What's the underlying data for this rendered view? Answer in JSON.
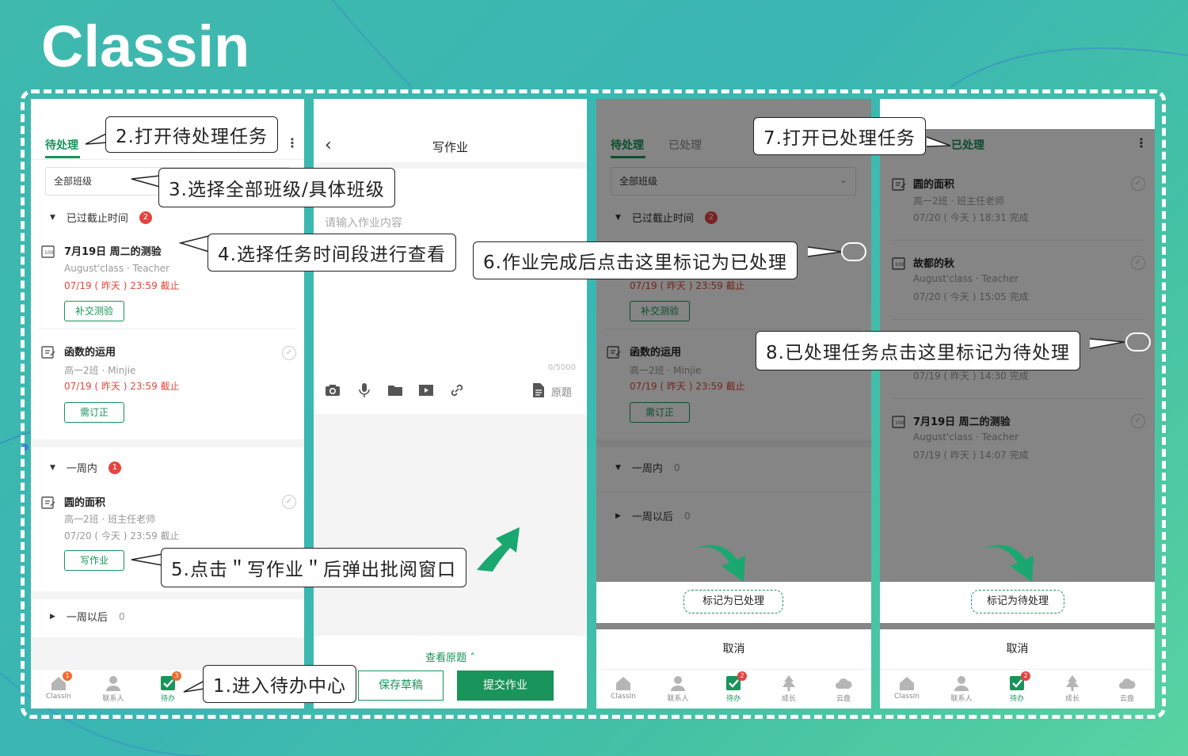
{
  "brand": {
    "logo_text": "Classin"
  },
  "panel1": {
    "tab_active": "待处理",
    "class_select": "全部班级",
    "section_overdue": {
      "label": "已过截止时间",
      "count": "2"
    },
    "task1": {
      "title": "7月19日 周二的测验",
      "meta": "August'class · Teacher",
      "due": "07/19 ( 昨天 ) 23:59 截止",
      "button": "补交测验"
    },
    "task2": {
      "title": "函数的运用",
      "meta": "高一2班 · Minjie",
      "due": "07/19 ( 昨天 ) 23:59 截止",
      "button": "需订正"
    },
    "section_week": {
      "label": "一周内",
      "count": "1"
    },
    "task3": {
      "title": "圆的面积",
      "meta": "高一2班 · 班主任老师",
      "due": "07/20 ( 今天 ) 23:59 截止",
      "button": "写作业"
    },
    "section_later": {
      "label": "一周以后",
      "count": "0"
    }
  },
  "panel2": {
    "title": "写作业",
    "placeholder": "请输入作业内容",
    "counter": "0/5000",
    "original_label": "原题",
    "view_original": "查看原题",
    "save_draft": "保存草稿",
    "submit": "提交作业"
  },
  "panel3": {
    "tab_active": "待处理",
    "tab_inactive": "已处理",
    "class_select": "全部班级",
    "section_overdue": {
      "label": "已过截止时间",
      "count": "2"
    },
    "partial_due": "07/19 ( 昨天 ) 23:59 截止",
    "button1": "补交测验",
    "task2": {
      "title": "函数的运用",
      "meta": "高一2班 · Minjie",
      "due": "07/19 ( 昨天 ) 23:59 截止",
      "button": "需订正"
    },
    "section_week": {
      "label": "一周内",
      "count": "0"
    },
    "section_later": {
      "label": "一周以后",
      "count": "0"
    },
    "sheet_action": "标记为已处理",
    "sheet_cancel": "取消"
  },
  "panel4": {
    "tab_active": "已处理",
    "item1": {
      "title": "圆的面积",
      "meta": "高一2班 · 班主任老师",
      "done": "07/20 ( 今天 ) 18:31 完成"
    },
    "item2": {
      "title": "故都的秋",
      "meta": "August'class · Teacher",
      "done": "07/20 ( 今天 ) 15:05 完成"
    },
    "item3_partial": "07/19 ( 昨天 ) 14:30 完成",
    "item4": {
      "title": "7月19日 周二的测验",
      "meta": "August'class · Teacher",
      "done": "07/19 ( 昨天 ) 14:07 完成"
    },
    "sheet_action": "标记为待处理",
    "sheet_cancel": "取消"
  },
  "nav": {
    "classin": "ClassIn",
    "contacts": "联系人",
    "todo": "待办",
    "growth": "成长",
    "cloud": "云盘",
    "p1_classin_badge": "1",
    "p1_todo_badge": "3",
    "todo_badge": "2",
    "icons": [
      "home-icon",
      "contacts-icon",
      "todo-icon",
      "growth-icon",
      "cloud-icon"
    ]
  },
  "callouts": {
    "c1": "1.进入待办中心",
    "c2": "2.打开待处理任务",
    "c3": "3.选择全部班级/具体班级",
    "c4": "4.选择任务时间段进行查看",
    "c5": "5.点击＂写作业＂后弹出批阅窗口",
    "c6": "6.作业完成后点击这里标记为已处理",
    "c7": "7.打开已处理任务",
    "c8": "8.已处理任务点击这里标记为待处理"
  },
  "colors": {
    "brand_green": "#19945a",
    "badge_red": "#e64340",
    "background_teal": "#3fb9ad"
  }
}
